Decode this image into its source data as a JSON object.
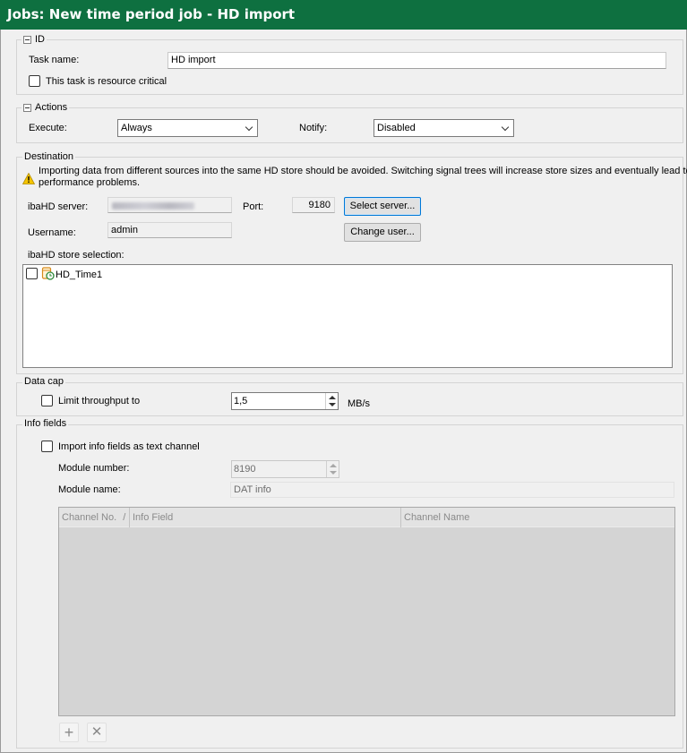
{
  "title": "Jobs: New time period job - HD import",
  "id_section": {
    "legend": "ID",
    "task_name_label": "Task name:",
    "task_name_value": "HD import",
    "resource_critical_label": "This task is resource critical",
    "resource_critical_checked": false
  },
  "actions_section": {
    "legend": "Actions",
    "execute_label": "Execute:",
    "execute_value": "Always",
    "notify_label": "Notify:",
    "notify_value": "Disabled"
  },
  "destination_section": {
    "legend": "Destination",
    "warning_text_1": "Importing data from different sources into the same HD store should be avoided. Switching signal trees will increase store sizes and eventually lead to",
    "warning_text_2": "performance problems.",
    "server_label": "ibaHD server:",
    "port_label": "Port:",
    "port_value": "9180",
    "select_server_button": "Select server...",
    "username_label": "Username:",
    "username_value": "admin",
    "change_user_button": "Change user...",
    "store_selection_label": "ibaHD store selection:",
    "stores": [
      {
        "name": "HD_Time1",
        "checked": false
      }
    ]
  },
  "data_cap_section": {
    "legend": "Data cap",
    "limit_label": "Limit throughput to",
    "limit_checked": false,
    "limit_value": "1,5",
    "unit": "MB/s"
  },
  "info_fields_section": {
    "legend": "Info fields",
    "import_label": "Import info fields as text channel",
    "import_checked": false,
    "module_number_label": "Module number:",
    "module_number_value": "8190",
    "module_name_label": "Module name:",
    "module_name_value": "DAT info",
    "columns": [
      "Channel No.",
      "Info Field",
      "Channel Name"
    ],
    "sort_indicator": "/",
    "add_icon": "+",
    "remove_icon": "✕"
  },
  "icons": {
    "warning": "warning-triangle-icon",
    "store": "hd-store-icon",
    "collapse": "collapse-icon"
  },
  "colors": {
    "title_bar": "#0e7040",
    "focus_border": "#0078d7"
  }
}
